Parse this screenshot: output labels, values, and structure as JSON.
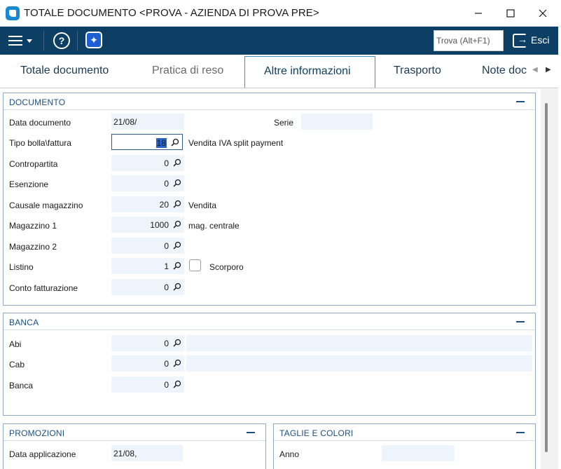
{
  "window": {
    "title": "TOTALE DOCUMENTO <PROVA - AZIENDA DI PROVA PRE>",
    "minimize_icon": "minimize-icon",
    "maximize_icon": "maximize-icon",
    "close_icon": "close-icon"
  },
  "toolbar": {
    "search_placeholder": "Trova (Alt+F1)",
    "exit_label": "Esci",
    "help_symbol": "?",
    "ai_symbol": "✦"
  },
  "tabs": [
    {
      "label": "Totale documento",
      "active": false
    },
    {
      "label": "Pratica di reso",
      "active": false
    },
    {
      "label": "Altre informazioni",
      "active": true
    },
    {
      "label": "Trasporto",
      "active": false
    },
    {
      "label": "Note doc",
      "active": false
    }
  ],
  "documento": {
    "title": "DOCUMENTO",
    "data_documento": {
      "label": "Data documento",
      "value": "21/08/"
    },
    "serie": {
      "label": "Serie",
      "value": ""
    },
    "tipo_bolla": {
      "label": "Tipo bolla\\fattura",
      "value": "18",
      "desc": "Vendita IVA split payment"
    },
    "contropartita": {
      "label": "Contropartita",
      "value": "0"
    },
    "esenzione": {
      "label": "Esenzione",
      "value": "0"
    },
    "causale_magazzino": {
      "label": "Causale magazzino",
      "value": "20",
      "desc": "Vendita"
    },
    "magazzino1": {
      "label": "Magazzino 1",
      "value": "1000",
      "desc": "mag. centrale"
    },
    "magazzino2": {
      "label": "Magazzino 2",
      "value": "0"
    },
    "listino": {
      "label": "Listino",
      "value": "1",
      "checkbox_label": "Scorporo",
      "checked": false
    },
    "conto_fatturazione": {
      "label": "Conto fatturazione",
      "value": "0"
    }
  },
  "banca": {
    "title": "BANCA",
    "abi": {
      "label": "Abi",
      "value": "0"
    },
    "cab": {
      "label": "Cab",
      "value": "0"
    },
    "banca": {
      "label": "Banca",
      "value": "0"
    }
  },
  "promozioni": {
    "title": "PROMOZIONI",
    "data_applicazione": {
      "label": "Data applicazione",
      "value": "21/08,"
    }
  },
  "taglie": {
    "title": "TAGLIE E COLORI",
    "anno": {
      "label": "Anno",
      "value": ""
    }
  },
  "colors": {
    "toolbar_bg": "#0c3f63",
    "accent": "#1a4f80",
    "field_bg": "#eef4fb",
    "panel_border": "#8fa9c2"
  }
}
